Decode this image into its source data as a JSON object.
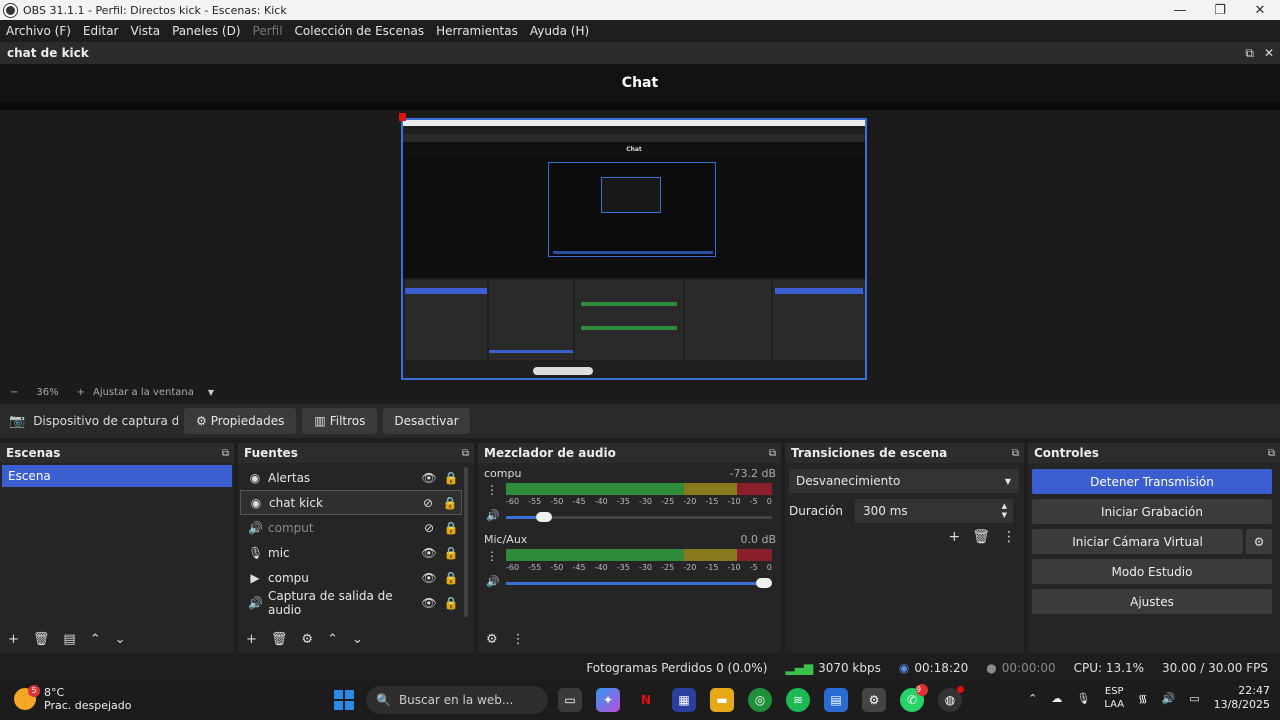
{
  "window": {
    "title": "OBS 31.1.1 - Perfil: Directos kick - Escenas: Kick",
    "minimize": "—",
    "maximize": "❐",
    "close": "✕"
  },
  "menu": [
    {
      "label": "Archivo (F)",
      "disabled": false
    },
    {
      "label": "Editar",
      "disabled": false
    },
    {
      "label": "Vista",
      "disabled": false
    },
    {
      "label": "Paneles (D)",
      "disabled": false
    },
    {
      "label": "Perfil",
      "disabled": true
    },
    {
      "label": "Colección de Escenas",
      "disabled": false
    },
    {
      "label": "Herramientas",
      "disabled": false
    },
    {
      "label": "Ayuda (H)",
      "disabled": false
    }
  ],
  "chat_dock": {
    "title": "chat de kick",
    "float_icon": "⧉",
    "close_icon": "✕",
    "chat_heading": "Chat"
  },
  "preview": {
    "inner_chat_label": "Chat",
    "zoom_minus": "−",
    "zoom_value": "36%",
    "zoom_plus": "+",
    "fit_label": "Ajustar a la ventana"
  },
  "source_toolbar": {
    "source_name": "Dispositivo de captura de v",
    "properties": "Propiedades",
    "filters": "Filtros",
    "deactivate": "Desactivar"
  },
  "scenes": {
    "title": "Escenas",
    "items": [
      "Escena"
    ]
  },
  "sources": {
    "title": "Fuentes",
    "items": [
      {
        "label": "Alertas",
        "icon": "globe-icon",
        "glyph": "◉",
        "visible": true
      },
      {
        "label": "chat kick",
        "icon": "globe-icon",
        "glyph": "◉",
        "visible": false
      },
      {
        "label": "comput",
        "icon": "speaker-icon",
        "glyph": "🔊",
        "visible": false
      },
      {
        "label": "mic",
        "icon": "microphone-icon",
        "glyph": "🎙",
        "visible": true
      },
      {
        "label": "compu",
        "icon": "play-icon",
        "glyph": "▶",
        "visible": true
      },
      {
        "label": "Captura de salida de audio",
        "icon": "speaker-icon",
        "glyph": "🔊",
        "visible": true
      }
    ]
  },
  "mixer": {
    "title": "Mezclador de audio",
    "ticks": [
      "-60",
      "-55",
      "-50",
      "-45",
      "-40",
      "-35",
      "-30",
      "-25",
      "-20",
      "-15",
      "-10",
      "-5",
      "0"
    ],
    "channels": [
      {
        "name": "compu",
        "db": "-73.2 dB",
        "volume": 0.12
      },
      {
        "name": "Mic/Aux",
        "db": "0.0 dB",
        "volume": 1.0
      }
    ]
  },
  "transitions": {
    "title": "Transiciones de escena",
    "selected": "Desvanecimiento",
    "duration_label": "Duración",
    "duration_value": "300 ms"
  },
  "controls": {
    "title": "Controles",
    "stop_stream": "Detener Transmisión",
    "start_recording": "Iniciar Grabación",
    "start_virtual_camera": "Iniciar Cámara Virtual",
    "studio_mode": "Modo Estudio",
    "settings": "Ajustes"
  },
  "status": {
    "dropped_frames": "Fotogramas Perdidos 0 (0.0%)",
    "bitrate": "3070 kbps",
    "stream_time": "00:18:20",
    "record_time": "00:00:00",
    "cpu": "CPU: 13.1%",
    "fps": "30.00 / 30.00 FPS"
  },
  "taskbar": {
    "weather_badge": "5",
    "weather_temp": "8°C",
    "weather_desc": "Prac. despejado",
    "search_placeholder": "Buscar en la web...",
    "whatsapp_badge": "9",
    "lang_top": "ESP",
    "lang_bottom": "LAA",
    "time": "22:47",
    "date": "13/8/2025"
  },
  "colors": {
    "accent": "#3b5fd0",
    "meter_green": "#2e8b3a",
    "meter_yellow": "#8a7a1e",
    "meter_red": "#8a1e2a"
  }
}
